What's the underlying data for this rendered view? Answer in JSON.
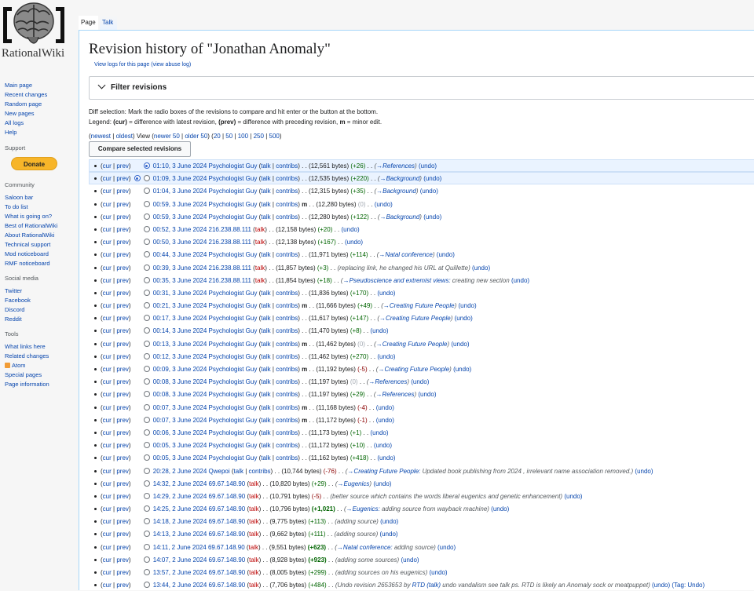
{
  "site": {
    "logo_text": "RationalWiki",
    "logo_icon": "brain-in-brackets-logo"
  },
  "tabs": [
    {
      "label": "Page",
      "active": true
    },
    {
      "label": "Talk",
      "active": false
    }
  ],
  "sidebar": {
    "main": [
      "Main page",
      "Recent changes",
      "Random page",
      "New pages",
      "All logs",
      "Help"
    ],
    "support_heading": "Support",
    "donate_label": "Donate",
    "community_heading": "Community",
    "community": [
      "Saloon bar",
      "To do list",
      "What is going on?",
      "Best of RationalWiki",
      "About RationalWiki",
      "Technical support",
      "Mod noticeboard",
      "RMF noticeboard"
    ],
    "social_heading": "Social media",
    "social": [
      "Twitter",
      "Facebook",
      "Discord",
      "Reddit"
    ],
    "tools_heading": "Tools",
    "tools": [
      "What links here",
      "Related changes",
      "Atom",
      "Special pages",
      "Page information"
    ]
  },
  "page": {
    "title": "Revision history of \"Jonathan Anomaly\"",
    "view_logs": "View logs for this page",
    "view_abuse_log": "(view abuse log)",
    "filter_label": "Filter revisions",
    "diff_selection": "Diff selection: Mark the radio boxes of the revisions to compare and hit enter or the button at the bottom.",
    "legend_prefix": "Legend: ",
    "legend_cur": "(cur)",
    "legend_cur_desc": " = difference with latest revision, ",
    "legend_prev": "(prev)",
    "legend_prev_desc": " = difference with preceding revision, ",
    "legend_m": "m",
    "legend_m_desc": " = minor edit.",
    "nav": {
      "newest": "newest",
      "oldest": "oldest",
      "view": "View",
      "newer": "newer 50",
      "older": "older 50",
      "limits": [
        "20",
        "50",
        "100",
        "250",
        "500"
      ]
    },
    "compare_button": "Compare selected revisions"
  },
  "revisions": [
    {
      "date": "01:10, 3 June 2024",
      "user": "Psychologist Guy",
      "ip": false,
      "minor": false,
      "size": "(12,561 bytes)",
      "diff": "(+26)",
      "diff_kind": "pos",
      "summary_section": "→References",
      "summary_text": "",
      "extra": "",
      "undo": "(undo)",
      "tag": "",
      "radio": "right",
      "selected": true
    },
    {
      "date": "01:09, 3 June 2024",
      "user": "Psychologist Guy",
      "ip": false,
      "minor": false,
      "size": "(12,535 bytes)",
      "diff": "(+220)",
      "diff_kind": "pos",
      "summary_section": "→Background",
      "summary_text": "",
      "extra": "",
      "undo": "(undo)",
      "tag": "",
      "radio": "left",
      "selected": true
    },
    {
      "date": "01:04, 3 June 2024",
      "user": "Psychologist Guy",
      "ip": false,
      "minor": false,
      "size": "(12,315 bytes)",
      "diff": "(+35)",
      "diff_kind": "pos",
      "summary_section": "→Background",
      "summary_text": "",
      "extra": "",
      "undo": "(undo)",
      "tag": "",
      "radio": "both",
      "selected": false
    },
    {
      "date": "00:59, 3 June 2024",
      "user": "Psychologist Guy",
      "ip": false,
      "minor": true,
      "size": "(12,280 bytes)",
      "diff": "(0)",
      "diff_kind": "zero",
      "summary_section": "",
      "summary_text": "",
      "extra": "",
      "undo": "(undo)",
      "tag": "",
      "radio": "both",
      "selected": false
    },
    {
      "date": "00:59, 3 June 2024",
      "user": "Psychologist Guy",
      "ip": false,
      "minor": false,
      "size": "(12,280 bytes)",
      "diff": "(+122)",
      "diff_kind": "pos",
      "summary_section": "→Background",
      "summary_text": "",
      "extra": "",
      "undo": "(undo)",
      "tag": "",
      "radio": "both",
      "selected": false
    },
    {
      "date": "00:52, 3 June 2024",
      "user": "216.238.88.111",
      "ip": true,
      "minor": false,
      "size": "(12,158 bytes)",
      "diff": "(+20)",
      "diff_kind": "pos",
      "summary_section": "",
      "summary_text": "",
      "extra": "",
      "undo": "(undo)",
      "tag": "",
      "radio": "both",
      "selected": false
    },
    {
      "date": "00:50, 3 June 2024",
      "user": "216.238.88.111",
      "ip": true,
      "minor": false,
      "size": "(12,138 bytes)",
      "diff": "(+167)",
      "diff_kind": "pos",
      "summary_section": "",
      "summary_text": "",
      "extra": "",
      "undo": "(undo)",
      "tag": "",
      "radio": "both",
      "selected": false
    },
    {
      "date": "00:44, 3 June 2024",
      "user": "Psychologist Guy",
      "ip": false,
      "minor": false,
      "size": "(11,971 bytes)",
      "diff": "(+114)",
      "diff_kind": "pos",
      "summary_section": "→Natal conference",
      "summary_text": "",
      "extra": "",
      "undo": "(undo)",
      "tag": "",
      "radio": "both",
      "selected": false
    },
    {
      "date": "00:39, 3 June 2024",
      "user": "216.238.88.111",
      "ip": true,
      "minor": false,
      "size": "(11,857 bytes)",
      "diff": "(+3)",
      "diff_kind": "pos",
      "summary_section": "",
      "summary_text": "(replacing link, he changed his URL at Quillette)",
      "extra": "",
      "undo": "(undo)",
      "tag": "",
      "radio": "both",
      "selected": false
    },
    {
      "date": "00:35, 3 June 2024",
      "user": "216.238.88.111",
      "ip": true,
      "minor": false,
      "size": "(11,854 bytes)",
      "diff": "(+18)",
      "diff_kind": "pos",
      "summary_section": "→Pseudoscience and extremist views:",
      "summary_text": " creating new section",
      "extra": "",
      "undo": "(undo)",
      "tag": "",
      "radio": "both",
      "selected": false
    },
    {
      "date": "00:31, 3 June 2024",
      "user": "Psychologist Guy",
      "ip": false,
      "minor": false,
      "size": "(11,836 bytes)",
      "diff": "(+170)",
      "diff_kind": "pos",
      "summary_section": "",
      "summary_text": "",
      "extra": "",
      "undo": "(undo)",
      "tag": "",
      "radio": "both",
      "selected": false
    },
    {
      "date": "00:21, 3 June 2024",
      "user": "Psychologist Guy",
      "ip": false,
      "minor": true,
      "size": "(11,666 bytes)",
      "diff": "(+49)",
      "diff_kind": "pos",
      "summary_section": "→Creating Future People",
      "summary_text": "",
      "extra": "",
      "undo": "(undo)",
      "tag": "",
      "radio": "both",
      "selected": false
    },
    {
      "date": "00:17, 3 June 2024",
      "user": "Psychologist Guy",
      "ip": false,
      "minor": false,
      "size": "(11,617 bytes)",
      "diff": "(+147)",
      "diff_kind": "pos",
      "summary_section": "→Creating Future People",
      "summary_text": "",
      "extra": "",
      "undo": "(undo)",
      "tag": "",
      "radio": "both",
      "selected": false
    },
    {
      "date": "00:14, 3 June 2024",
      "user": "Psychologist Guy",
      "ip": false,
      "minor": false,
      "size": "(11,470 bytes)",
      "diff": "(+8)",
      "diff_kind": "pos",
      "summary_section": "",
      "summary_text": "",
      "extra": "",
      "undo": "(undo)",
      "tag": "",
      "radio": "both",
      "selected": false
    },
    {
      "date": "00:13, 3 June 2024",
      "user": "Psychologist Guy",
      "ip": false,
      "minor": true,
      "size": "(11,462 bytes)",
      "diff": "(0)",
      "diff_kind": "zero",
      "summary_section": "→Creating Future People",
      "summary_text": "",
      "extra": "",
      "undo": "(undo)",
      "tag": "",
      "radio": "both",
      "selected": false
    },
    {
      "date": "00:12, 3 June 2024",
      "user": "Psychologist Guy",
      "ip": false,
      "minor": false,
      "size": "(11,462 bytes)",
      "diff": "(+270)",
      "diff_kind": "pos",
      "summary_section": "",
      "summary_text": "",
      "extra": "",
      "undo": "(undo)",
      "tag": "",
      "radio": "both",
      "selected": false
    },
    {
      "date": "00:09, 3 June 2024",
      "user": "Psychologist Guy",
      "ip": false,
      "minor": true,
      "size": "(11,192 bytes)",
      "diff": "(-5)",
      "diff_kind": "neg",
      "summary_section": "→Creating Future People",
      "summary_text": "",
      "extra": "",
      "undo": "(undo)",
      "tag": "",
      "radio": "both",
      "selected": false
    },
    {
      "date": "00:08, 3 June 2024",
      "user": "Psychologist Guy",
      "ip": false,
      "minor": false,
      "size": "(11,197 bytes)",
      "diff": "(0)",
      "diff_kind": "zero",
      "summary_section": "→References",
      "summary_text": "",
      "extra": "",
      "undo": "(undo)",
      "tag": "",
      "radio": "both",
      "selected": false
    },
    {
      "date": "00:08, 3 June 2024",
      "user": "Psychologist Guy",
      "ip": false,
      "minor": false,
      "size": "(11,197 bytes)",
      "diff": "(+29)",
      "diff_kind": "pos",
      "summary_section": "→References",
      "summary_text": "",
      "extra": "",
      "undo": "(undo)",
      "tag": "",
      "radio": "both",
      "selected": false
    },
    {
      "date": "00:07, 3 June 2024",
      "user": "Psychologist Guy",
      "ip": false,
      "minor": true,
      "size": "(11,168 bytes)",
      "diff": "(-4)",
      "diff_kind": "neg",
      "summary_section": "",
      "summary_text": "",
      "extra": "",
      "undo": "(undo)",
      "tag": "",
      "radio": "both",
      "selected": false
    },
    {
      "date": "00:07, 3 June 2024",
      "user": "Psychologist Guy",
      "ip": false,
      "minor": true,
      "size": "(11,172 bytes)",
      "diff": "(-1)",
      "diff_kind": "neg",
      "summary_section": "",
      "summary_text": "",
      "extra": "",
      "undo": "(undo)",
      "tag": "",
      "radio": "both",
      "selected": false
    },
    {
      "date": "00:06, 3 June 2024",
      "user": "Psychologist Guy",
      "ip": false,
      "minor": false,
      "size": "(11,173 bytes)",
      "diff": "(+1)",
      "diff_kind": "pos",
      "summary_section": "",
      "summary_text": "",
      "extra": "",
      "undo": "(undo)",
      "tag": "",
      "radio": "both",
      "selected": false
    },
    {
      "date": "00:05, 3 June 2024",
      "user": "Psychologist Guy",
      "ip": false,
      "minor": false,
      "size": "(11,172 bytes)",
      "diff": "(+10)",
      "diff_kind": "pos",
      "summary_section": "",
      "summary_text": "",
      "extra": "",
      "undo": "(undo)",
      "tag": "",
      "radio": "both",
      "selected": false
    },
    {
      "date": "00:05, 3 June 2024",
      "user": "Psychologist Guy",
      "ip": false,
      "minor": false,
      "size": "(11,162 bytes)",
      "diff": "(+418)",
      "diff_kind": "pos",
      "summary_section": "",
      "summary_text": "",
      "extra": "",
      "undo": "(undo)",
      "tag": "",
      "radio": "both",
      "selected": false
    },
    {
      "date": "20:28, 2 June 2024",
      "user": "Qwepoi",
      "ip": false,
      "minor": false,
      "size": "(10,744 bytes)",
      "diff": "(-76)",
      "diff_kind": "neg",
      "summary_section": "→Creating Future People:",
      "summary_text": " Updated book publishing from 2024 , irrelevant name association removed.)",
      "extra": "",
      "undo": "(undo)",
      "tag": "",
      "radio": "both",
      "selected": false
    },
    {
      "date": "14:32, 2 June 2024",
      "user": "69.67.148.90",
      "ip": true,
      "minor": false,
      "size": "(10,820 bytes)",
      "diff": "(+29)",
      "diff_kind": "pos",
      "summary_section": "→Eugenics",
      "summary_text": "",
      "extra": "",
      "undo": "(undo)",
      "tag": "",
      "radio": "both",
      "selected": false
    },
    {
      "date": "14:29, 2 June 2024",
      "user": "69.67.148.90",
      "ip": true,
      "minor": false,
      "size": "(10,791 bytes)",
      "diff": "(-5)",
      "diff_kind": "neg",
      "summary_section": "",
      "summary_text": "(better source which contains the words liberal eugenics and genetic enhancement)",
      "extra": "",
      "undo": "(undo)",
      "tag": "",
      "radio": "both",
      "selected": false
    },
    {
      "date": "14:25, 2 June 2024",
      "user": "69.67.148.90",
      "ip": true,
      "minor": false,
      "size": "(10,796 bytes)",
      "diff": "(+1,021)",
      "diff_kind": "posb",
      "summary_section": "→Eugenics:",
      "summary_text": " adding source from wayback machine)",
      "extra": "",
      "undo": "(undo)",
      "tag": "",
      "radio": "both",
      "selected": false
    },
    {
      "date": "14:18, 2 June 2024",
      "user": "69.67.148.90",
      "ip": true,
      "minor": false,
      "size": "(9,775 bytes)",
      "diff": "(+113)",
      "diff_kind": "pos",
      "summary_section": "",
      "summary_text": "(adding source)",
      "extra": "",
      "undo": "(undo)",
      "tag": "",
      "radio": "both",
      "selected": false
    },
    {
      "date": "14:13, 2 June 2024",
      "user": "69.67.148.90",
      "ip": true,
      "minor": false,
      "size": "(9,662 bytes)",
      "diff": "(+111)",
      "diff_kind": "pos",
      "summary_section": "",
      "summary_text": "(adding source)",
      "extra": "",
      "undo": "(undo)",
      "tag": "",
      "radio": "both",
      "selected": false
    },
    {
      "date": "14:11, 2 June 2024",
      "user": "69.67.148.90",
      "ip": true,
      "minor": false,
      "size": "(9,551 bytes)",
      "diff": "(+623)",
      "diff_kind": "posb",
      "summary_section": "→Natal conference:",
      "summary_text": " adding source)",
      "extra": "",
      "undo": "(undo)",
      "tag": "",
      "radio": "both",
      "selected": false
    },
    {
      "date": "14:07, 2 June 2024",
      "user": "69.67.148.90",
      "ip": true,
      "minor": false,
      "size": "(8,928 bytes)",
      "diff": "(+923)",
      "diff_kind": "posb",
      "summary_section": "",
      "summary_text": "(adding some sources)",
      "extra": "",
      "undo": "(undo)",
      "tag": "",
      "radio": "both",
      "selected": false
    },
    {
      "date": "13:57, 2 June 2024",
      "user": "69.67.148.90",
      "ip": true,
      "minor": false,
      "size": "(8,005 bytes)",
      "diff": "(+299)",
      "diff_kind": "pos",
      "summary_section": "",
      "summary_text": "(adding sources on his eugenics)",
      "extra": "",
      "undo": "(undo)",
      "tag": "",
      "radio": "both",
      "selected": false
    },
    {
      "date": "13:44, 2 June 2024",
      "user": "69.67.148.90",
      "ip": true,
      "minor": false,
      "size": "(7,706 bytes)",
      "diff": "(+484)",
      "diff_kind": "pos",
      "summary_section": "",
      "summary_text": "(Undo revision 2653653 by ",
      "extra": "RTD|(talk)| undo vandalism see talk ps. RTD is likely an Anomaly sock or meatpuppet)",
      "undo": "(undo)",
      "tag": "(Tag: Undo)",
      "radio": "both",
      "selected": false
    }
  ],
  "labels": {
    "cur": "cur",
    "prev": "prev",
    "talk": "talk",
    "contribs": "contribs",
    "m": "m",
    "dots": ". ."
  },
  "colors": {
    "link": "#0645ad",
    "red_link": "#ba0000",
    "positive": "#006400",
    "negative": "#8b0000",
    "zero": "#a2a9b1",
    "selected_row": "#eaf3ff",
    "donate": "#f7b529"
  }
}
